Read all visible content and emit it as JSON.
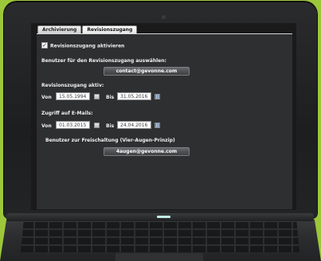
{
  "tabs": [
    {
      "label": "Archivierung",
      "active": false
    },
    {
      "label": "Revisionszugang",
      "active": true
    }
  ],
  "revision_access": {
    "checkbox_label": "Revisionszugang aktivieren",
    "checked": true
  },
  "user_select": {
    "heading": "Benutzer für den Revisionszugang auswählen:",
    "button_label": "contact@gevonne.com"
  },
  "access_active": {
    "heading": "Revisionszugang aktiv:",
    "from_label": "Von",
    "from_value": "15.05.1994",
    "to_label": "Bis",
    "to_value": "31.05.2016"
  },
  "email_access": {
    "heading": "Zugriff auf E-Mails:",
    "from_label": "Von",
    "from_value": "01.03.2015",
    "to_label": "Bis",
    "to_value": "24.04.2016"
  },
  "approval": {
    "heading": "Benutzer zur Freischaltung (Vier-Augen-Prinzip)",
    "button_label": "4augen@gevonne.com"
  },
  "icons": {
    "checkbox": "check-icon",
    "date_picker": "calendar-icon"
  },
  "colors": {
    "background": "#9dc73a",
    "panel": "#2e2f31",
    "button": "#505154",
    "text": "#f0f0f0"
  }
}
